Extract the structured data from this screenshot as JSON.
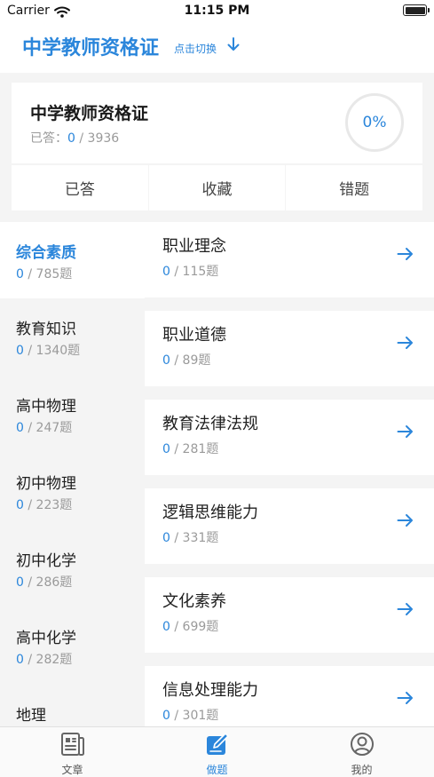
{
  "status": {
    "carrier": "Carrier",
    "time": "11:15 PM",
    "battery_level": 1.0
  },
  "header": {
    "title": "中学教师资格证",
    "switch_label": "点击切换"
  },
  "summary": {
    "title": "中学教师资格证",
    "answered_label": "已答：",
    "answered": "0",
    "total": "/ 3936",
    "progress": "0%"
  },
  "tabs": {
    "answered": "已答",
    "favorites": "收藏",
    "wrong": "错题"
  },
  "categories": [
    {
      "name": "综合素质",
      "done": "0",
      "count": "/ 785题",
      "active": true
    },
    {
      "name": "教育知识",
      "done": "0",
      "count": "/ 1340题"
    },
    {
      "name": "高中物理",
      "done": "0",
      "count": "/ 247题"
    },
    {
      "name": "初中物理",
      "done": "0",
      "count": "/ 223题"
    },
    {
      "name": "初中化学",
      "done": "0",
      "count": "/ 286题"
    },
    {
      "name": "高中化学",
      "done": "0",
      "count": "/ 282题"
    },
    {
      "name": "地理",
      "done": "",
      "count": ""
    }
  ],
  "subjects": [
    {
      "name": "职业理念",
      "done": "0",
      "count": "/ 115题"
    },
    {
      "name": "职业道德",
      "done": "0",
      "count": "/ 89题"
    },
    {
      "name": "教育法律法规",
      "done": "0",
      "count": "/ 281题"
    },
    {
      "name": "逻辑思维能力",
      "done": "0",
      "count": "/ 331题"
    },
    {
      "name": "文化素养",
      "done": "0",
      "count": "/ 699题"
    },
    {
      "name": "信息处理能力",
      "done": "0",
      "count": "/ 301题"
    }
  ],
  "tabbar": {
    "items": [
      {
        "label": "文章",
        "icon": "article-icon"
      },
      {
        "label": "做题",
        "icon": "edit-icon",
        "active": true
      },
      {
        "label": "我的",
        "icon": "profile-icon"
      }
    ]
  },
  "colors": {
    "accent": "#2b86db",
    "background_gray": "#f4f4f4",
    "muted_text": "#9a9a9a"
  }
}
